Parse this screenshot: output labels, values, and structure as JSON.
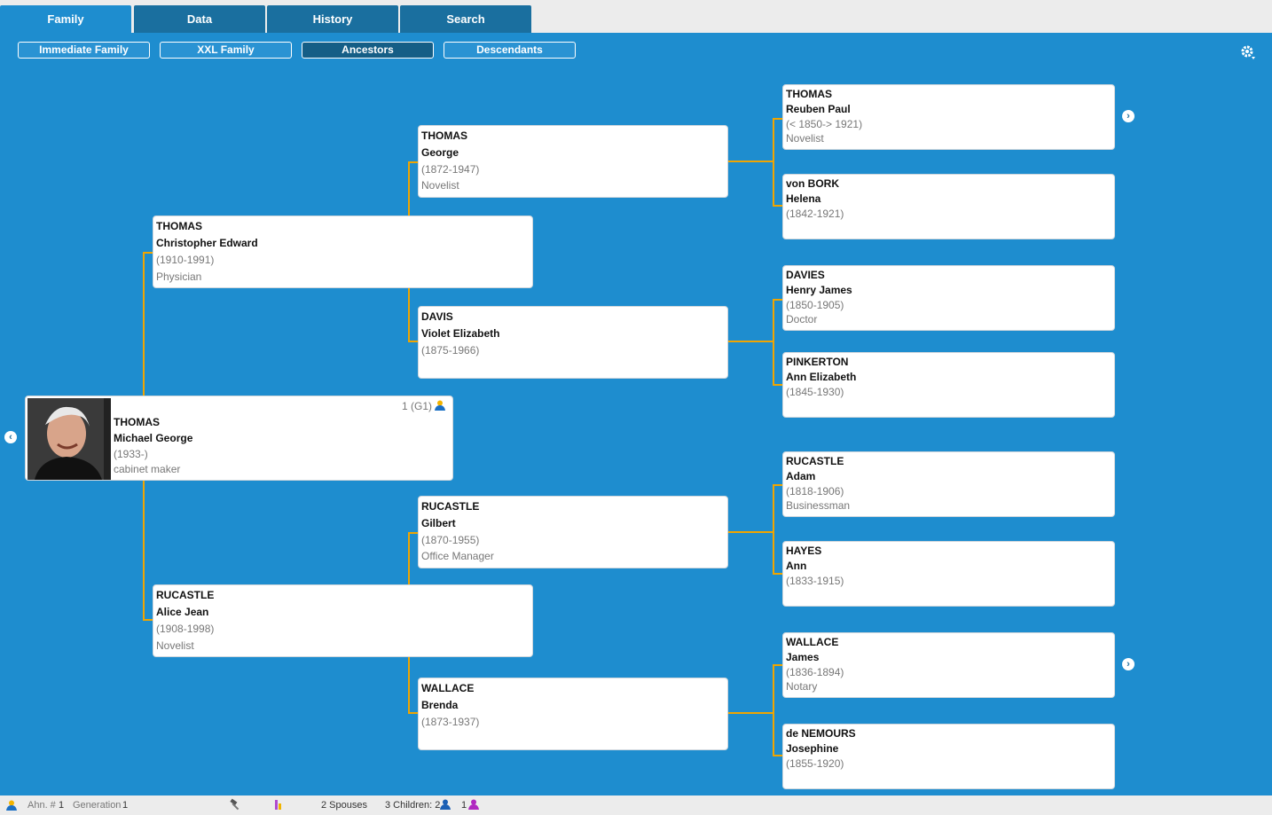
{
  "tabs": [
    "Family",
    "Data",
    "History",
    "Search"
  ],
  "subtabs": [
    "Immediate Family",
    "XXL Family",
    "Ancestors",
    "Descendants"
  ],
  "root": {
    "surname": "THOMAS",
    "given": "Michael George",
    "dates": "(1933-)",
    "occupation": "cabinet maker",
    "badge": "1 (G1)"
  },
  "gen1": {
    "father": {
      "surname": "THOMAS",
      "given": "Christopher Edward",
      "dates": "(1910-1991)",
      "occupation": "Physician"
    },
    "mother": {
      "surname": "RUCASTLE",
      "given": "Alice Jean",
      "dates": "(1908-1998)",
      "occupation": "Novelist"
    }
  },
  "gen2": {
    "ff": {
      "surname": "THOMAS",
      "given": "George",
      "dates": "(1872-1947)",
      "occupation": "Novelist"
    },
    "fm": {
      "surname": "DAVIS",
      "given": "Violet Elizabeth",
      "dates": "(1875-1966)",
      "occupation": ""
    },
    "mf": {
      "surname": "RUCASTLE",
      "given": "Gilbert",
      "dates": "(1870-1955)",
      "occupation": "Office Manager"
    },
    "mm": {
      "surname": "WALLACE",
      "given": "Brenda",
      "dates": "(1873-1937)",
      "occupation": ""
    }
  },
  "gen3": {
    "fff": {
      "surname": "THOMAS",
      "given": "Reuben Paul",
      "dates": "(< 1850-> 1921)",
      "occupation": "Novelist"
    },
    "ffm": {
      "surname": "von BORK",
      "given": "Helena",
      "dates": "(1842-1921)",
      "occupation": ""
    },
    "fmf": {
      "surname": "DAVIES",
      "given": "Henry James",
      "dates": "(1850-1905)",
      "occupation": "Doctor"
    },
    "fmm": {
      "surname": "PINKERTON",
      "given": "Ann Elizabeth",
      "dates": "(1845-1930)",
      "occupation": ""
    },
    "mff": {
      "surname": "RUCASTLE",
      "given": "Adam",
      "dates": "(1818-1906)",
      "occupation": "Businessman"
    },
    "mfm": {
      "surname": "HAYES",
      "given": "Ann",
      "dates": "(1833-1915)",
      "occupation": ""
    },
    "mmf": {
      "surname": "WALLACE",
      "given": "James",
      "dates": "(1836-1894)",
      "occupation": "Notary"
    },
    "mmm": {
      "surname": "de NEMOURS",
      "given": "Josephine",
      "dates": "(1855-1920)",
      "occupation": ""
    }
  },
  "nav": {
    "left": "‹",
    "right": "›"
  },
  "status": {
    "ahn_label": "Ahn. #",
    "ahn_value": "1",
    "gen_label": "Generation",
    "gen_value": "1",
    "spouses": "2 Spouses",
    "children": "3 Children: 2",
    "children_female": "1"
  },
  "colors": {
    "background": "#1e8dcf",
    "tab": "#1a6f9f",
    "connector": "#f0a500"
  }
}
